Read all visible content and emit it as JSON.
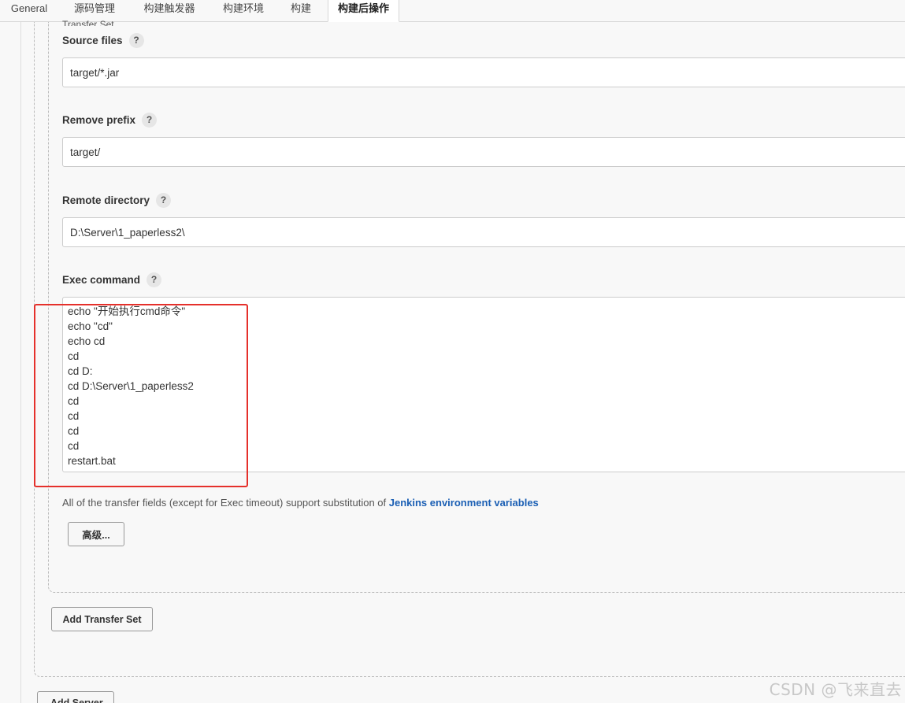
{
  "tabs": [
    {
      "label": "General",
      "active": false
    },
    {
      "label": "源码管理",
      "active": false
    },
    {
      "label": "构建触发器",
      "active": false
    },
    {
      "label": "构建环境",
      "active": false
    },
    {
      "label": "构建",
      "active": false
    },
    {
      "label": "构建后操作",
      "active": true
    }
  ],
  "transfer_set": {
    "title": "Transfer Set",
    "source_files": {
      "label": "Source files",
      "value": "target/*.jar"
    },
    "remove_prefix": {
      "label": "Remove prefix",
      "value": "target/"
    },
    "remote_directory": {
      "label": "Remote directory",
      "value": "D:\\Server\\1_paperless2\\"
    },
    "exec_command": {
      "label": "Exec command",
      "lines": [
        "echo \"开始执行cmd命令\"",
        "echo \"cd\"",
        "echo cd",
        "cd",
        "cd D:",
        "cd D:\\Server\\1_paperless2",
        "cd",
        "cd",
        "cd",
        "cd",
        "restart.bat"
      ]
    },
    "help_symbol": "?",
    "hint_text": "All of the transfer fields (except for Exec timeout) support substitution of ",
    "hint_link": "Jenkins environment variables",
    "advanced_button": "高级...",
    "add_transfer_set_button": "Add Transfer Set"
  },
  "add_server_button": "Add Server",
  "watermark": "CSDN @飞来直去",
  "highlight_color": "#e5302b"
}
